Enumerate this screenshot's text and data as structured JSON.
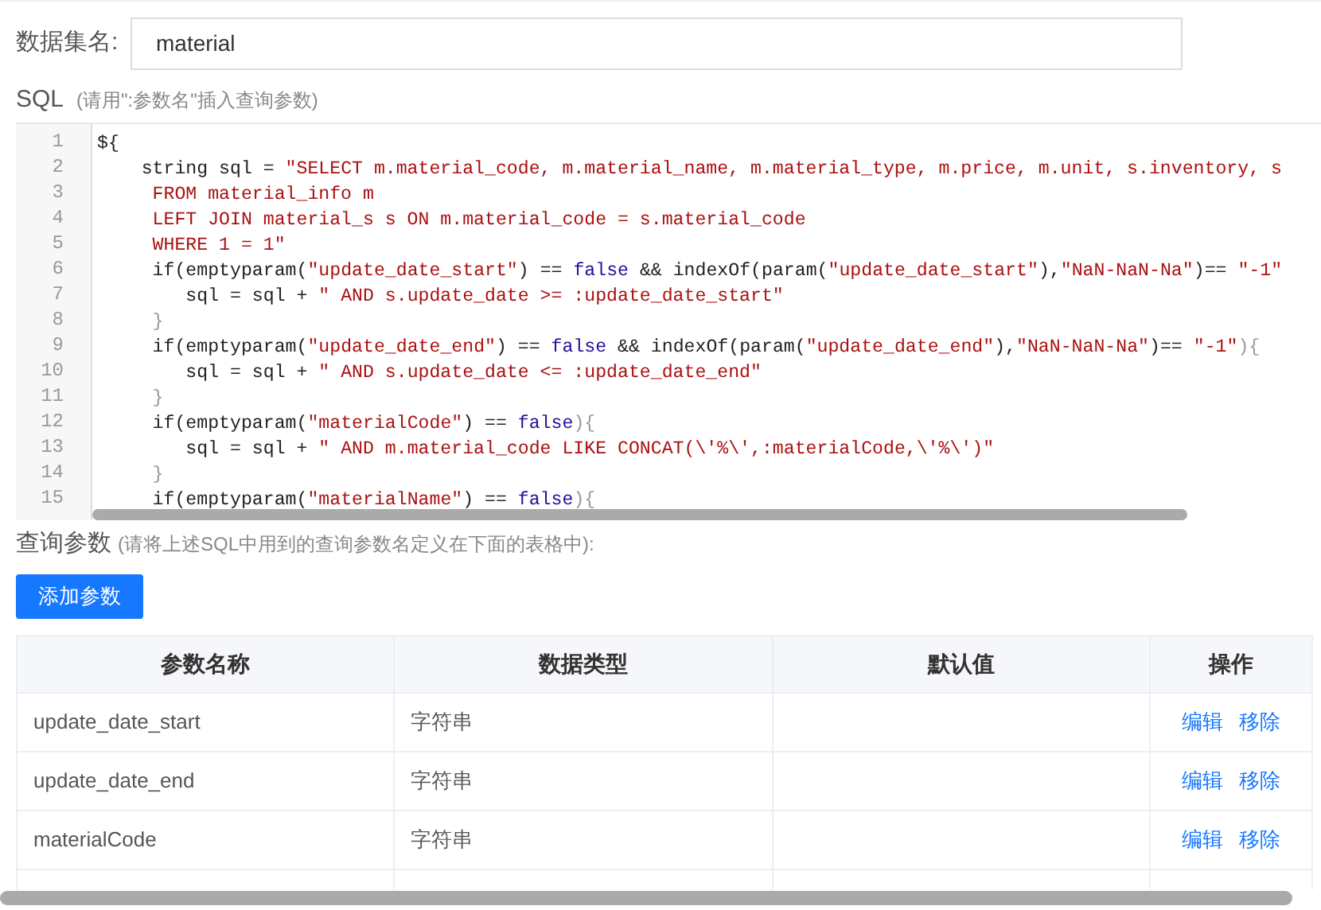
{
  "dataset": {
    "label": "数据集名:",
    "value": "material"
  },
  "sql": {
    "label": "SQL",
    "hint": "(请用\":参数名\"插入查询参数)",
    "lines": [
      {
        "number": "1",
        "tokens": [
          {
            "kind": "plain",
            "text": "${"
          }
        ]
      },
      {
        "number": "2",
        "tokens": [
          {
            "kind": "plain",
            "text": "    string sql = "
          },
          {
            "kind": "string",
            "text": "\"SELECT m.material_code, m.material_name, m.material_type, m.price, m.unit, s.inventory, s"
          }
        ]
      },
      {
        "number": "3",
        "tokens": [
          {
            "kind": "string",
            "text": "     FROM material_info m"
          }
        ]
      },
      {
        "number": "4",
        "tokens": [
          {
            "kind": "string",
            "text": "     LEFT JOIN material_s s ON m.material_code = s.material_code"
          }
        ]
      },
      {
        "number": "5",
        "tokens": [
          {
            "kind": "string",
            "text": "     WHERE 1 = 1\""
          }
        ]
      },
      {
        "number": "6",
        "tokens": [
          {
            "kind": "plain",
            "text": "     if(emptyparam("
          },
          {
            "kind": "string",
            "text": "\"update_date_start\""
          },
          {
            "kind": "plain",
            "text": ") == "
          },
          {
            "kind": "keyword",
            "text": "false"
          },
          {
            "kind": "plain",
            "text": " && indexOf(param("
          },
          {
            "kind": "string",
            "text": "\"update_date_start\""
          },
          {
            "kind": "plain",
            "text": "),"
          },
          {
            "kind": "string",
            "text": "\"NaN-NaN-Na\""
          },
          {
            "kind": "plain",
            "text": ")== "
          },
          {
            "kind": "string",
            "text": "\"-1\""
          }
        ]
      },
      {
        "number": "7",
        "tokens": [
          {
            "kind": "plain",
            "text": "        sql = sql + "
          },
          {
            "kind": "string",
            "text": "\" AND s.update_date >= :update_date_start\""
          }
        ]
      },
      {
        "number": "8",
        "tokens": [
          {
            "kind": "bracket",
            "text": "     }"
          }
        ]
      },
      {
        "number": "9",
        "tokens": [
          {
            "kind": "plain",
            "text": "     if(emptyparam("
          },
          {
            "kind": "string",
            "text": "\"update_date_end\""
          },
          {
            "kind": "plain",
            "text": ") == "
          },
          {
            "kind": "keyword",
            "text": "false"
          },
          {
            "kind": "plain",
            "text": " && indexOf(param("
          },
          {
            "kind": "string",
            "text": "\"update_date_end\""
          },
          {
            "kind": "plain",
            "text": "),"
          },
          {
            "kind": "string",
            "text": "\"NaN-NaN-Na\""
          },
          {
            "kind": "plain",
            "text": ")== "
          },
          {
            "kind": "string",
            "text": "\"-1\""
          },
          {
            "kind": "bracket",
            "text": "){"
          }
        ]
      },
      {
        "number": "10",
        "tokens": [
          {
            "kind": "plain",
            "text": "        sql = sql + "
          },
          {
            "kind": "string",
            "text": "\" AND s.update_date <= :update_date_end\""
          }
        ]
      },
      {
        "number": "11",
        "tokens": [
          {
            "kind": "bracket",
            "text": "     }"
          }
        ]
      },
      {
        "number": "12",
        "tokens": [
          {
            "kind": "plain",
            "text": "     if(emptyparam("
          },
          {
            "kind": "string",
            "text": "\"materialCode\""
          },
          {
            "kind": "plain",
            "text": ") == "
          },
          {
            "kind": "keyword",
            "text": "false"
          },
          {
            "kind": "bracket",
            "text": "){"
          }
        ]
      },
      {
        "number": "13",
        "tokens": [
          {
            "kind": "plain",
            "text": "        sql = sql + "
          },
          {
            "kind": "string",
            "text": "\" AND m.material_code LIKE CONCAT(\\'%\\',:materialCode,\\'%\\')\""
          }
        ]
      },
      {
        "number": "14",
        "tokens": [
          {
            "kind": "bracket",
            "text": "     }"
          }
        ]
      },
      {
        "number": "15",
        "tokens": [
          {
            "kind": "plain",
            "text": "     if(emptyparam("
          },
          {
            "kind": "string",
            "text": "\"materialName\""
          },
          {
            "kind": "plain",
            "text": ") == "
          },
          {
            "kind": "keyword",
            "text": "false"
          },
          {
            "kind": "bracket",
            "text": "){"
          }
        ]
      }
    ]
  },
  "params": {
    "label": "查询参数",
    "hint": "(请将上述SQL中用到的查询参数名定义在下面的表格中):",
    "add_button": "添加参数",
    "columns": [
      "参数名称",
      "数据类型",
      "默认值",
      "操作"
    ],
    "rows": [
      {
        "name": "update_date_start",
        "type": "字符串",
        "actions": [
          "编辑",
          "移除"
        ]
      },
      {
        "name": "update_date_end",
        "type": "字符串",
        "actions": [
          "编辑",
          "移除"
        ]
      },
      {
        "name": "materialCode",
        "type": "字符串",
        "actions": [
          "编辑",
          "移除"
        ]
      }
    ]
  }
}
